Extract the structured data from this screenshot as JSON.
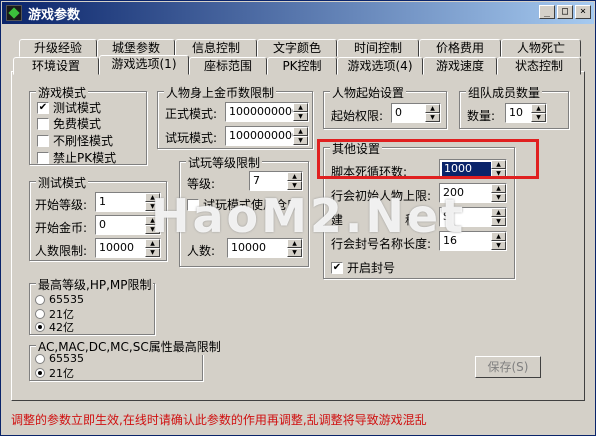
{
  "window": {
    "title": "游戏参数",
    "buttons": {
      "min": "_",
      "max": "□",
      "close": "×"
    }
  },
  "tabs_row1": [
    "升级经验",
    "城堡参数",
    "信息控制",
    "文字颜色",
    "时间控制",
    "价格费用",
    "人物死亡"
  ],
  "tabs_row2": [
    "环境设置",
    "游戏选项(1)",
    "座标范围",
    "PK控制",
    "游戏选项(4)",
    "游戏速度",
    "状态控制"
  ],
  "game_mode": {
    "title": "游戏模式",
    "items": [
      {
        "label": "测试模式",
        "checked": true
      },
      {
        "label": "免费模式",
        "checked": false
      },
      {
        "label": "不刷怪模式",
        "checked": false
      },
      {
        "label": "禁止PK模式",
        "checked": false
      }
    ]
  },
  "gold_limit": {
    "title": "人物身上金币数限制",
    "formal_label": "正式模式:",
    "formal_value": "1000000000",
    "trial_label": "试玩模式:",
    "trial_value": "1000000000"
  },
  "start_settings": {
    "title": "人物起始设置",
    "perm_label": "起始权限:",
    "perm_value": "0"
  },
  "team": {
    "title": "组队成员数量",
    "count_label": "数量:",
    "count_value": "10"
  },
  "test_mode": {
    "title": "测试模式",
    "level_label": "开始等级:",
    "level_value": "1",
    "gold_label": "开始金币:",
    "gold_value": "0",
    "people_label": "人数限制:",
    "people_value": "10000"
  },
  "trial_level": {
    "title": "试玩等级限制",
    "level_label": "等级:",
    "level_value": "7",
    "chk_label": "试玩模式使用仓库",
    "people_label": "人数:",
    "people_value": "10000"
  },
  "other": {
    "title": "其他设置",
    "script_label": "脚本死循环数:",
    "script_value": "1000",
    "guild_label": "行会初始人物上限:",
    "guild_value": "200",
    "row3_label": "建",
    "row3_mid": "称",
    "row3_value": "S",
    "row4_label": "行会封号名称长度:",
    "row4_value": "16",
    "seal_label": "开启封号",
    "seal_checked": true
  },
  "max_level": {
    "title": "最高等级,HP,MP限制",
    "options": [
      "65535",
      "21亿",
      "42亿"
    ],
    "selected": 2
  },
  "attr_limit": {
    "title": "AC,MAC,DC,MC,SC属性最高限制",
    "options": [
      "65535",
      "21亿"
    ],
    "selected": 1
  },
  "save_button": "保存(S)",
  "status_text": "调整的参数立即生效,在线时请确认此参数的作用再调整,乱调整将导致游戏混乱",
  "watermark": "HaoM2.Net",
  "colors": {
    "title_start": "#0a246a",
    "title_end": "#a6caf0",
    "status": "#d01010",
    "highlight": "#e02020"
  }
}
